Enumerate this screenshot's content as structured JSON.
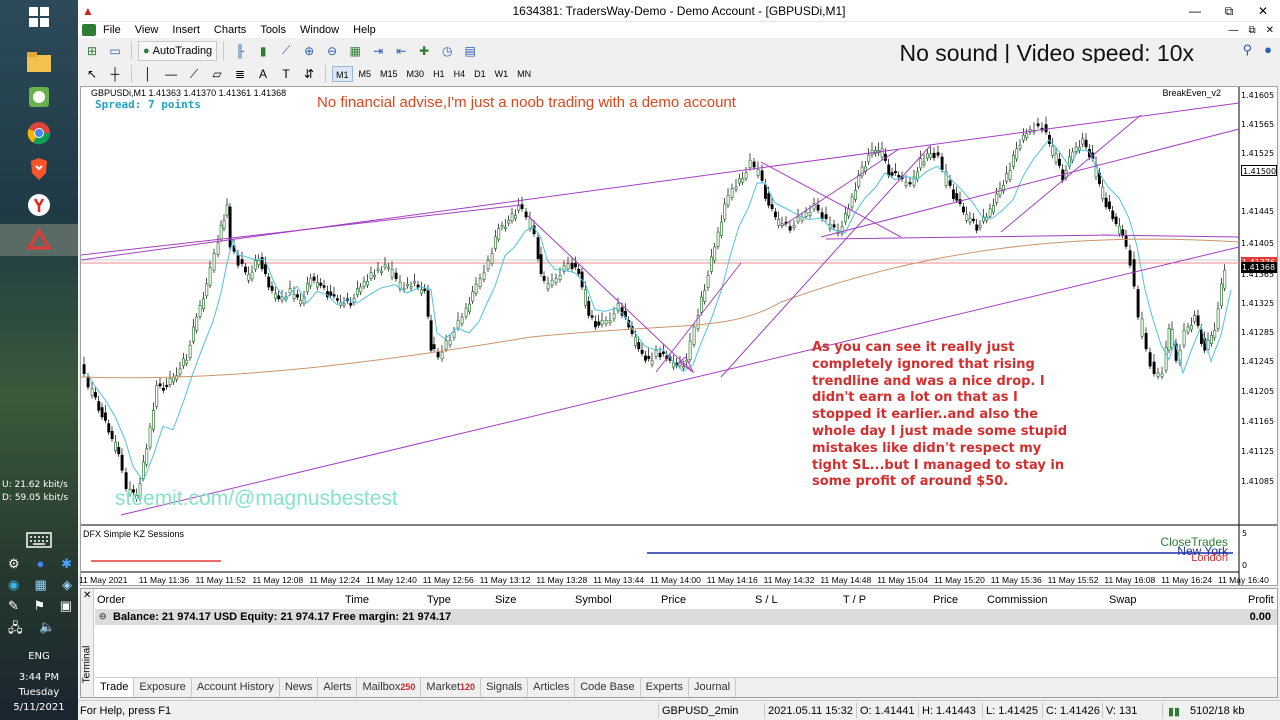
{
  "taskbar": {
    "net_up": "U:    21.62 kbit/s",
    "net_down": "D:    59.05 kbit/s",
    "language": "ENG",
    "time": "3:44 PM",
    "day": "Tuesday",
    "date": "5/11/2021"
  },
  "window": {
    "title": "1634381: TradersWay-Demo - Demo Account - [GBPUSDi,M1]",
    "minimize": "—",
    "maximize": "⧉",
    "close": "✕"
  },
  "menu": [
    "File",
    "View",
    "Insert",
    "Charts",
    "Tools",
    "Window",
    "Help"
  ],
  "toolbar": {
    "autotrading_label": "AutoTrading",
    "timeframes": [
      "M1",
      "M5",
      "M15",
      "M30",
      "H1",
      "H4",
      "D1",
      "W1",
      "MN"
    ],
    "selected_timeframe": "M1"
  },
  "overlay": {
    "speed_text": "No sound | Video speed: 10x",
    "disclaimer": "No financial advise,I'm just a noob trading with a demo account",
    "annotation": "As you can see it really just completely ignored that rising trendline and was a nice drop. I didn't earn a lot on that as I stopped it earlier..and also the whole day I just made some stupid mistakes like didn't respect my tight SL...but I managed to stay in some profit of around $50.",
    "watermark": "steemit.com/@magnusbestest"
  },
  "chart": {
    "header": "GBPUSDi,M1  1.41363 1.41370 1.41361 1.41368",
    "spread": "Spread: 7 points",
    "indicator": "BreakEven_v2",
    "sub_window": "DFX Simple KZ Sessions",
    "close_trades": "CloseTrades",
    "new_york": "New York",
    "london": "London",
    "current_price": "1.41368",
    "ref_price": "1.41500",
    "red_line_price": "1.41376",
    "sub_scale_top": "5",
    "sub_scale_bottom": "0",
    "price_labels": [
      "1.41605",
      "1.41565",
      "1.41525",
      "1.41500",
      "1.41445",
      "1.41405",
      "1.41365",
      "1.41325",
      "1.41285",
      "1.41245",
      "1.41205",
      "1.41165",
      "1.41125",
      "1.41085"
    ],
    "time_labels": [
      "11 May 2021",
      "11 May 11:36",
      "11 May 11:52",
      "11 May 12:08",
      "11 May 12:24",
      "11 May 12:40",
      "11 May 12:56",
      "11 May 13:12",
      "11 May 13:28",
      "11 May 13:44",
      "11 May 14:00",
      "11 May 14:16",
      "11 May 14:32",
      "11 May 14:48",
      "11 May 15:04",
      "11 May 15:20",
      "11 May 15:36",
      "11 May 15:52",
      "11 May 16:08",
      "11 May 16:24",
      "11 May 16:40"
    ]
  },
  "terminal": {
    "side_label": "Terminal",
    "columns": [
      "Order",
      "Time",
      "Type",
      "Size",
      "Symbol",
      "Price",
      "S / L",
      "T / P",
      "Price",
      "Commission",
      "Swap",
      "Profit"
    ],
    "balance_text": "Balance: 21 974.17 USD  Equity: 21 974.17  Free margin: 21 974.17",
    "profit": "0.00",
    "tabs": [
      {
        "label": "Trade",
        "badge": ""
      },
      {
        "label": "Exposure",
        "badge": ""
      },
      {
        "label": "Account History",
        "badge": ""
      },
      {
        "label": "News",
        "badge": ""
      },
      {
        "label": "Alerts",
        "badge": ""
      },
      {
        "label": "Mailbox",
        "badge": "250"
      },
      {
        "label": "Market",
        "badge": "120"
      },
      {
        "label": "Signals",
        "badge": ""
      },
      {
        "label": "Articles",
        "badge": ""
      },
      {
        "label": "Code Base",
        "badge": ""
      },
      {
        "label": "Experts",
        "badge": ""
      },
      {
        "label": "Journal",
        "badge": ""
      }
    ]
  },
  "statusbar": {
    "help": "For Help, press F1",
    "profile": "GBPUSD_2min",
    "datetime": "2021.05.11 15:32",
    "open": "O: 1.41441",
    "high": "H: 1.41443",
    "low": "L: 1.41425",
    "close": "C: 1.41426",
    "volume": "V: 131",
    "traffic": "5102/18 kb"
  }
}
